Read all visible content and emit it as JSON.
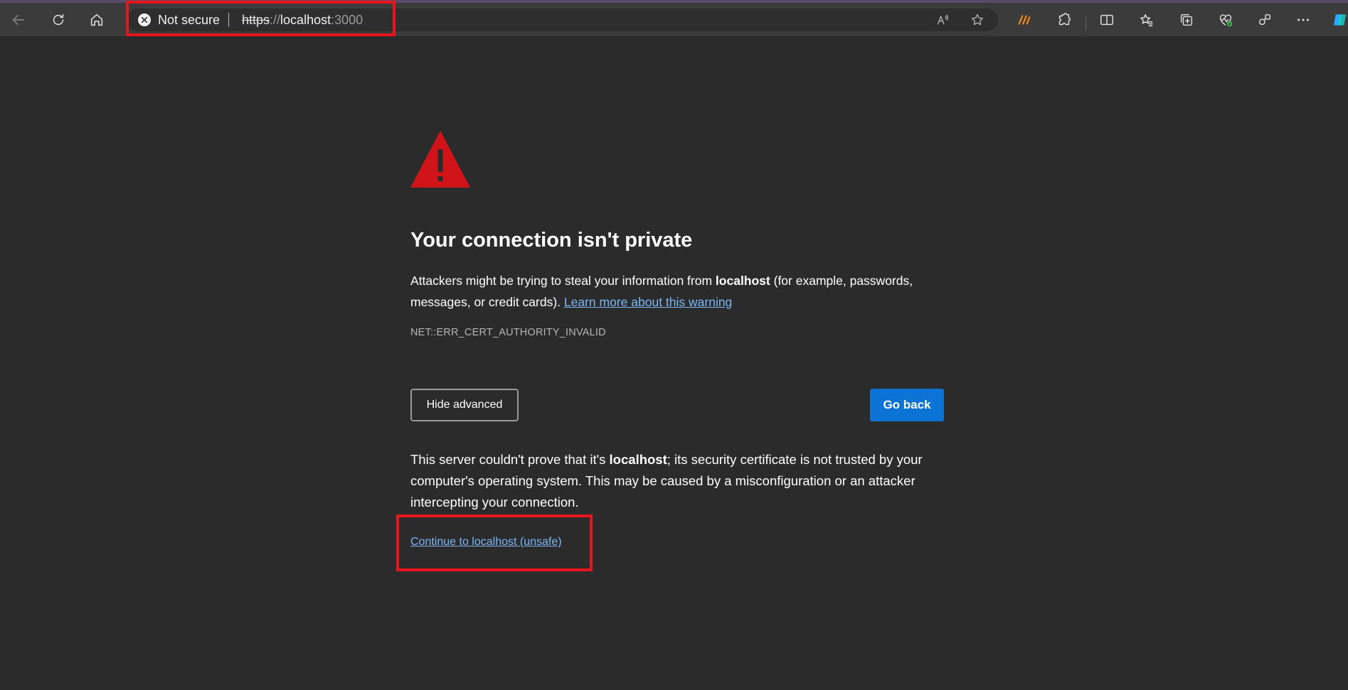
{
  "browser": {
    "security_label": "Not secure",
    "url_scheme": "https",
    "url_separator": "://",
    "url_host": "localhost",
    "url_port": ":3000",
    "icons": [
      "back-icon",
      "refresh-icon",
      "home-icon",
      "read-aloud-icon",
      "favorite-star-icon",
      "extension-app-icon",
      "extensions-puzzle-icon",
      "split-screen-icon",
      "favorites-icon",
      "collections-icon",
      "browser-essentials-icon",
      "share-icon",
      "more-icon"
    ]
  },
  "page": {
    "title": "Your connection isn't private",
    "desc_part1": "Attackers might be trying to steal your information from ",
    "desc_host": "localhost",
    "desc_part2": " (for example, passwords, messages, or credit cards). ",
    "learn_more": "Learn more about this warning",
    "error_code": "NET::ERR_CERT_AUTHORITY_INVALID",
    "hide_advanced": "Hide advanced",
    "go_back": "Go back",
    "details_part1": "This server couldn't prove that it's ",
    "details_host": "localhost",
    "details_part2": "; its security certificate is not trusted by your computer's operating system. This may be caused by a misconfiguration or an attacker intercepting your connection.",
    "continue_link": "Continue to localhost (unsafe)"
  },
  "colors": {
    "background": "#2b2b2b",
    "toolbar": "#3b3b3b",
    "warning_red": "#d0141a",
    "link": "#7cb6f5",
    "primary_button": "#0b73d4",
    "highlight_box": "#e8161c"
  }
}
